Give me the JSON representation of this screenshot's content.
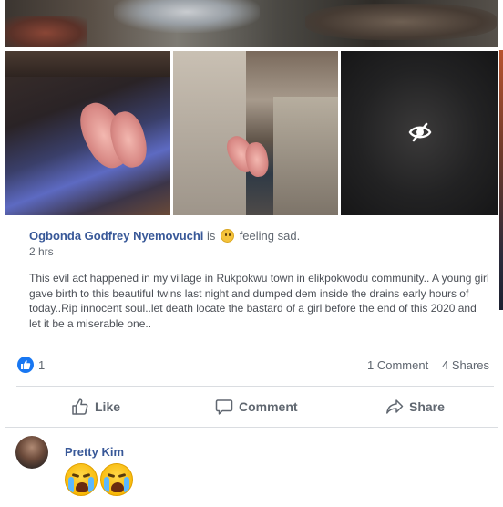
{
  "post": {
    "author": "Ogbonda Godfrey Nyemovuchi",
    "is_word": "is",
    "feeling": "feeling sad.",
    "time": "2 hrs",
    "text": "This evil act happened in my village in Rukpokwu town in elikpokwodu community.. A young girl gave birth to this beautiful twins last night and dumped dem inside the drains early hours of today..Rip innocent soul..let death locate the bastard of a girl before the end of this 2020 and let it be a miserable one.."
  },
  "reactions": {
    "like_count": "1",
    "comments": "1 Comment",
    "shares": "4 Shares"
  },
  "actions": {
    "like": "Like",
    "comment": "Comment",
    "share": "Share"
  },
  "comment": {
    "author": "Pretty Kim"
  },
  "colors": {
    "link_blue": "#385898",
    "like_blue": "#1877f2",
    "muted_text": "#606770"
  }
}
